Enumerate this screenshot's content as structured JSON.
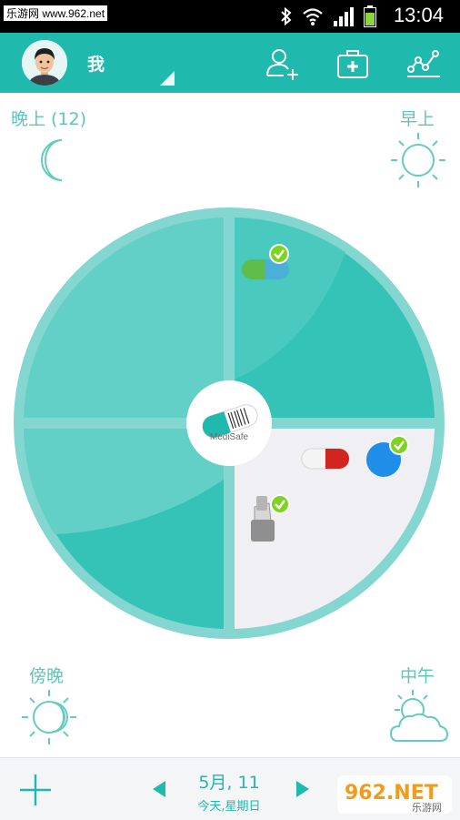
{
  "status_bar": {
    "site_label": "乐游网 www.962.net",
    "time": "13:04"
  },
  "header": {
    "user_name": "我",
    "actions": [
      {
        "name": "add-user-icon"
      },
      {
        "name": "medical-kit-icon"
      },
      {
        "name": "stats-chart-icon"
      }
    ]
  },
  "periods": {
    "evening": "晚上 (12)",
    "morning": "早上",
    "dusk": "傍晚",
    "noon": "中午"
  },
  "wheel": {
    "logo_text": "MediSafe",
    "colors": {
      "ring": "#84d6d0",
      "light_segment": "#63d0c7",
      "dark_segment": "#35c3b8",
      "active_segment": "#efeff4"
    }
  },
  "footer": {
    "date": "5月, 11",
    "day_label": "今天,星期日"
  },
  "watermark": {
    "text": "962.NET",
    "sub": "乐游网"
  },
  "colors": {
    "primary": "#20b9ae",
    "check": "#7ed321"
  }
}
